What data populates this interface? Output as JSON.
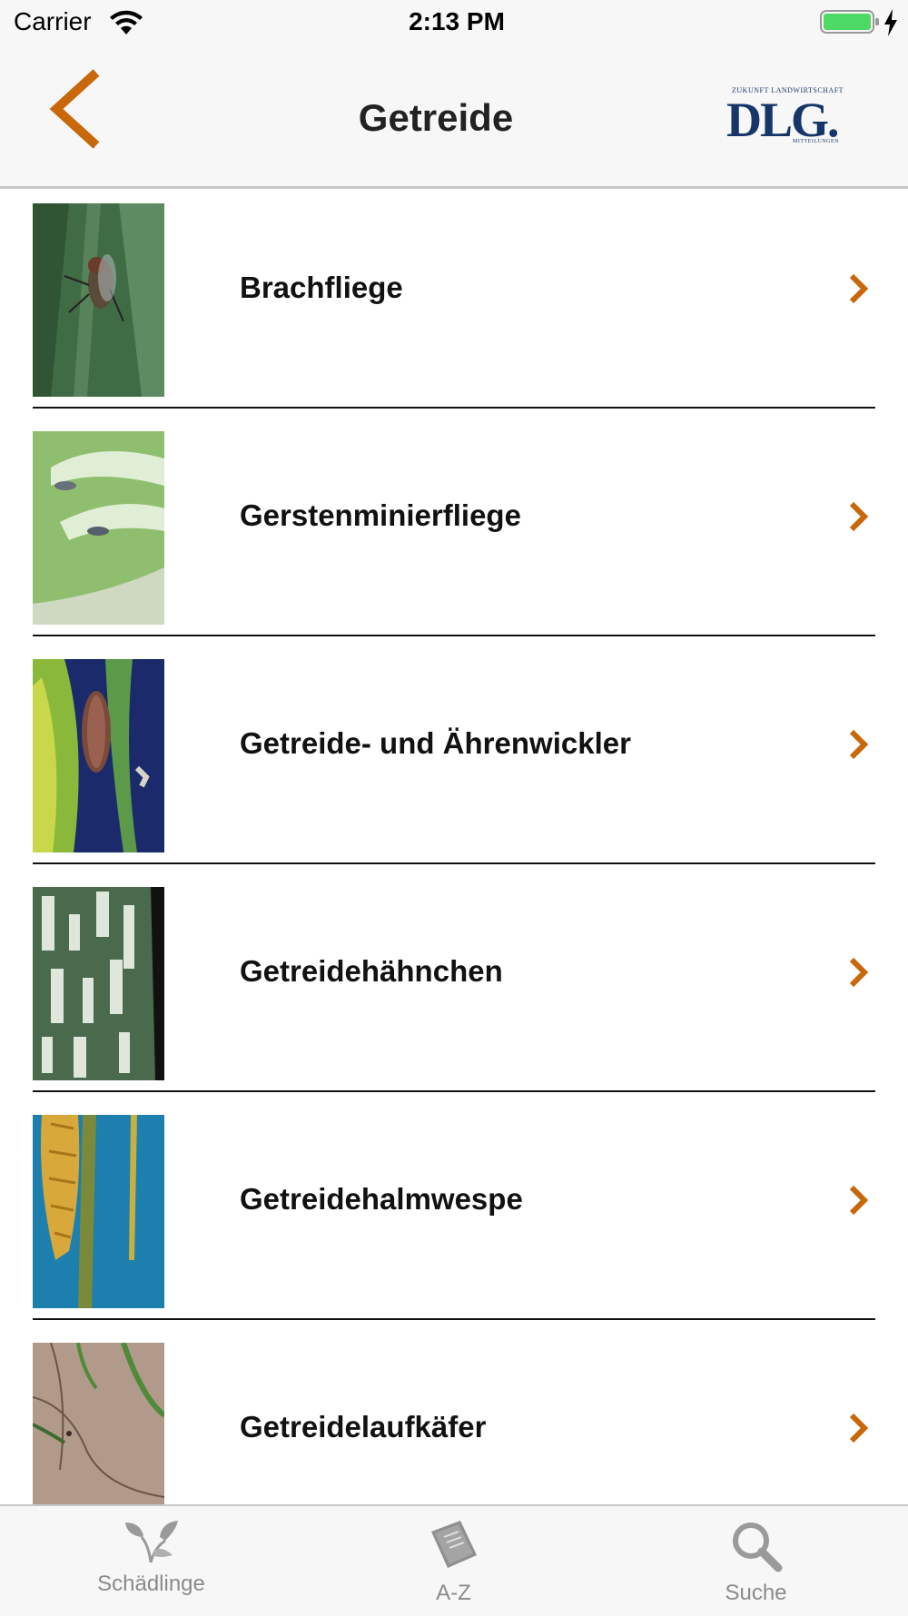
{
  "status_bar": {
    "carrier": "Carrier",
    "time": "2:13 PM"
  },
  "nav": {
    "title": "Getreide",
    "back_icon": "chevron-left-icon",
    "logo": {
      "top_text": "ZUKUNFT LANDWIRTSCHAFT",
      "main_text": "DLG.",
      "bottom_text": "MITTEILUNGEN"
    }
  },
  "colors": {
    "accent": "#c8680a",
    "bar_background": "#f7f7f7",
    "tab_inactive": "#8a8a8a",
    "logo_blue": "#16366a",
    "battery_green": "#4cd964"
  },
  "items": [
    {
      "label": "Brachfliege",
      "thumbnail": "fly-on-leaf-photo"
    },
    {
      "label": "Gerstenminierfliege",
      "thumbnail": "leaf-miner-damage-photo"
    },
    {
      "label": "Getreide- und Ährenwickler",
      "thumbnail": "caterpillar-on-stem-photo"
    },
    {
      "label": "Getreidehähnchen",
      "thumbnail": "striped-leaf-damage-photo"
    },
    {
      "label": "Getreidehalmwespe",
      "thumbnail": "wheat-ear-stem-photo"
    },
    {
      "label": "Getreidelaufkäfer",
      "thumbnail": "soil-seedling-photo"
    }
  ],
  "tabs": [
    {
      "label": "Schädlinge",
      "icon": "plant-sprout-icon"
    },
    {
      "label": "A-Z",
      "icon": "book-icon"
    },
    {
      "label": "Suche",
      "icon": "magnifier-icon"
    }
  ]
}
